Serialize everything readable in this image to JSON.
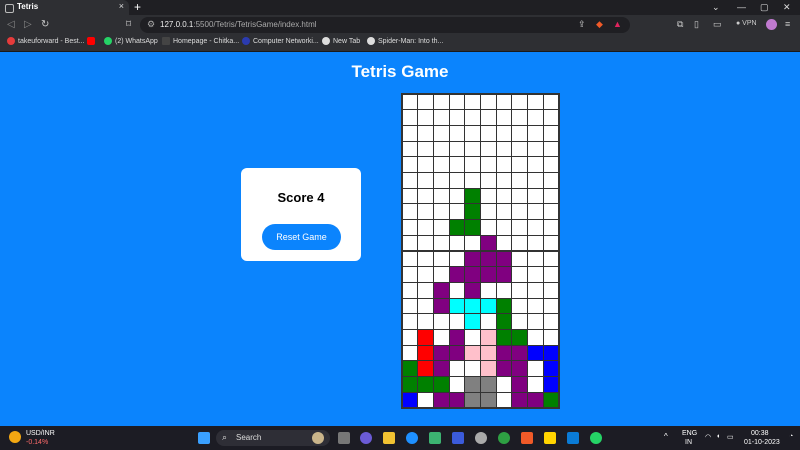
{
  "browser": {
    "tab_title": "Tetris",
    "tab_close": "×",
    "new_tab": "+",
    "url_host": "127.0.0.1",
    "url_rest": ":5500/Tetris/TetrisGame/index.html",
    "vpn_label": "● VPN",
    "window_controls": [
      "⌄",
      "—",
      "▢",
      "✕"
    ],
    "bookmarks": [
      {
        "label": "takeuforward - Best...",
        "color": "#e63b3b"
      },
      {
        "label": "",
        "color": "#ff0000"
      },
      {
        "label": "(2) WhatsApp",
        "color": "#25d366"
      },
      {
        "label": "Homepage - Chitka...",
        "color": "#444444"
      },
      {
        "label": "Computer Networki...",
        "color": "#2b3bb0"
      },
      {
        "label": "New Tab",
        "color": "#dddddd"
      },
      {
        "label": "Spider-Man: Into th...",
        "color": "#dddddd"
      }
    ]
  },
  "game": {
    "title": "Tetris Game",
    "score_text": "Score 4",
    "reset_label": "Reset Game"
  },
  "board": {
    "cols": 10,
    "rows": 20,
    "colors": {
      "W": "#ffffff",
      "G": "#008000",
      "P": "#800080",
      "C": "#00ffff",
      "R": "#ff0000",
      "K": "#ffc0cb",
      "B": "#0000ff",
      "Y": "#808080"
    },
    "grid": [
      "WWWWWWWWWW",
      "WWWWWWWWWW",
      "WWWWWWWWWW",
      "WWWWWWWWWW",
      "WWWWWWWWWW",
      "WWWWWWWWWW",
      "WWWWGWWWWW",
      "WWWWGWWWWW",
      "WWWGGWWWWW",
      "WWWWWPWWWW",
      "WWWWPPPWWW",
      "WWWPPPPWWW",
      "WWPWPWWWWW",
      "WWPCCCGWWW",
      "WWWWCWGWWW",
      "WRWPWKGGWW",
      "WRPPKKPPBB",
      "GRPWWKPPWB",
      "GGGWYYWPWB",
      "BWPPYYWPPG"
    ]
  },
  "taskbar": {
    "weather_title": "USD/INR",
    "weather_value": "-0.14%",
    "search_label": "Search",
    "lang_top": "ENG",
    "lang_bottom": "IN",
    "time": "00:38",
    "date": "01-10-2023",
    "tray_chevron": "^"
  }
}
